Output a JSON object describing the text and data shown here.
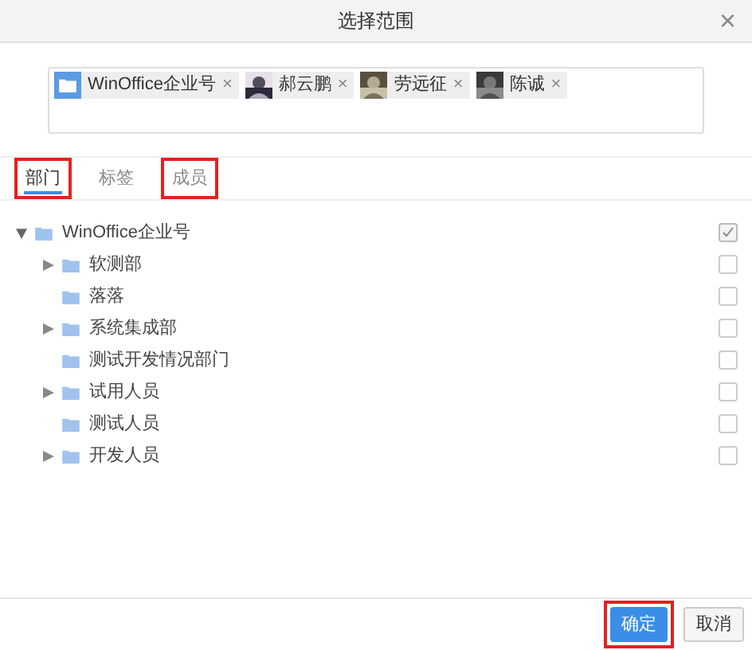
{
  "window": {
    "title": "选择范围",
    "close": "×"
  },
  "chips": [
    {
      "kind": "folder",
      "label": "WinOffice企业号",
      "remove": "×"
    },
    {
      "kind": "picture",
      "label": "郝云鹏",
      "remove": "×"
    },
    {
      "kind": "picture",
      "label": "劳远征",
      "remove": "×"
    },
    {
      "kind": "picture",
      "label": "陈诚",
      "remove": "×"
    }
  ],
  "tabs": [
    {
      "label": "部门",
      "selected": true,
      "highlighted": true
    },
    {
      "label": "标签",
      "selected": false,
      "highlighted": false
    },
    {
      "label": "成员",
      "selected": false,
      "highlighted": true
    }
  ],
  "tree": [
    {
      "label": "WinOffice企业号",
      "expanded": true,
      "checked": true,
      "children": [
        {
          "label": "软测部",
          "expanded": false,
          "checked": false
        },
        {
          "label": "落落",
          "checked": false
        },
        {
          "label": "系统集成部",
          "expanded": false,
          "checked": false
        },
        {
          "label": "测试开发情况部门",
          "checked": false
        },
        {
          "label": "试用人员",
          "expanded": false,
          "checked": false
        },
        {
          "label": "测试人员",
          "checked": false
        },
        {
          "label": "开发人员",
          "expanded": false,
          "checked": false
        }
      ]
    }
  ],
  "buttons": [
    {
      "label": "确定",
      "kind": "primary",
      "highlighted": true
    },
    {
      "label": "取消",
      "kind": "secondary"
    }
  ]
}
